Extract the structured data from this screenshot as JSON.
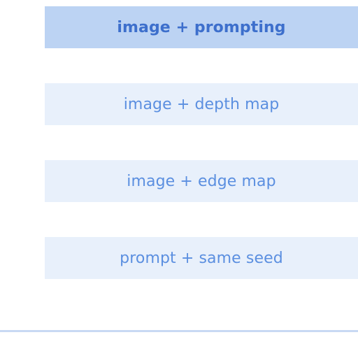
{
  "colors": {
    "selected_bg": "#bcd3f3",
    "selected_text": "#3d6fcc",
    "option_bg": "#e8f0fb",
    "option_text": "#5b8fe0",
    "divider": "#c8d9f3"
  },
  "modes": {
    "selected_index": 0,
    "options": [
      {
        "label": "image + prompting",
        "selected": true
      },
      {
        "label": "image + depth map",
        "selected": false
      },
      {
        "label": "image + edge map",
        "selected": false
      },
      {
        "label": "prompt + same seed",
        "selected": false
      }
    ]
  }
}
